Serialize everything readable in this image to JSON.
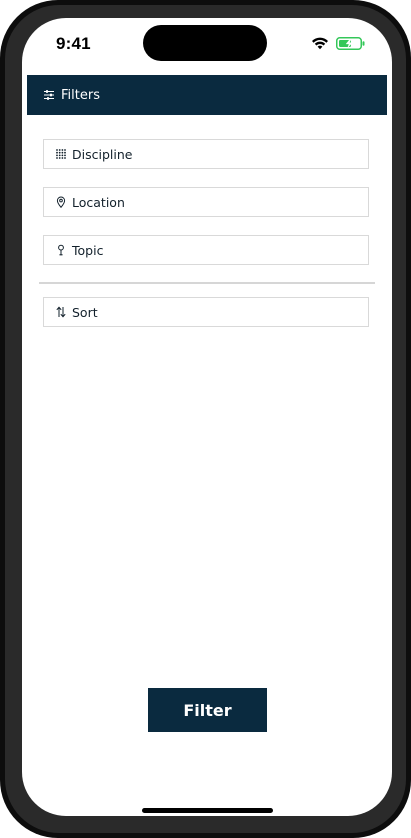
{
  "status_bar": {
    "time": "9:41",
    "wifi_icon": "wifi-icon",
    "battery_icon": "battery-charging-icon",
    "battery_color": "#34c759"
  },
  "header": {
    "title": "Filters",
    "icon": "sliders-icon",
    "background": "#0a2a3f"
  },
  "filters": [
    {
      "label": "Discipline",
      "icon": "grid-dots-icon"
    },
    {
      "label": "Location",
      "icon": "map-pin-icon"
    },
    {
      "label": "Topic",
      "icon": "pin-icon"
    }
  ],
  "sort": {
    "label": "Sort",
    "icon": "sort-arrows-icon"
  },
  "actions": {
    "filter_label": "Filter",
    "accent": "#0a2a3f"
  }
}
